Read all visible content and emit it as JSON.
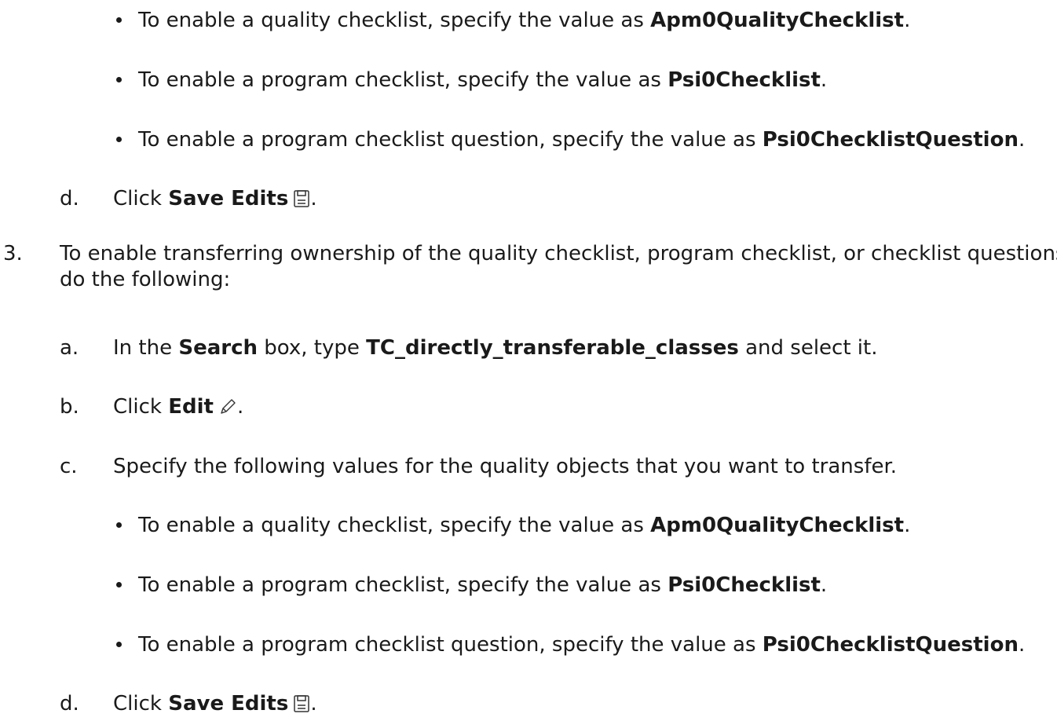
{
  "bullets_first": [
    {
      "text": "To enable a quality checklist, specify the value as ",
      "bold": "Apm0QualityChecklist",
      "end": "."
    },
    {
      "text": "To enable a program checklist, specify the value as ",
      "bold": "Psi0Checklist",
      "end": "."
    },
    {
      "text": "To enable a program checklist question, specify the value as ",
      "bold": "Psi0ChecklistQuestion",
      "end": "."
    }
  ],
  "step_d1": {
    "marker": "d.",
    "pre": "Click ",
    "bold": "Save Edits",
    "icon": "save-icon",
    "end": "."
  },
  "step3": {
    "marker": "3.",
    "line1": "To enable transferring ownership of the quality checklist, program checklist, or checklist questions,",
    "line2": "do the following:"
  },
  "step_a": {
    "marker": "a.",
    "pre": "In the ",
    "bold1": "Search",
    "mid": " box, type ",
    "bold2": "TC_directly_transferable_classes",
    "end": " and select it."
  },
  "step_b": {
    "marker": "b.",
    "pre": "Click ",
    "bold": "Edit",
    "icon": "pencil-icon",
    "end": "."
  },
  "step_c": {
    "marker": "c.",
    "text": "Specify the following values for the quality objects that you want to transfer."
  },
  "bullets_second": [
    {
      "text": "To enable a quality checklist, specify the value as ",
      "bold": "Apm0QualityChecklist",
      "end": "."
    },
    {
      "text": "To enable a program checklist, specify the value as ",
      "bold": "Psi0Checklist",
      "end": "."
    },
    {
      "text": "To enable a program checklist question, specify the value as ",
      "bold": "Psi0ChecklistQuestion",
      "end": "."
    }
  ],
  "step_d2": {
    "marker": "d.",
    "pre": "Click ",
    "bold": "Save Edits",
    "icon": "save-icon",
    "end": "."
  }
}
